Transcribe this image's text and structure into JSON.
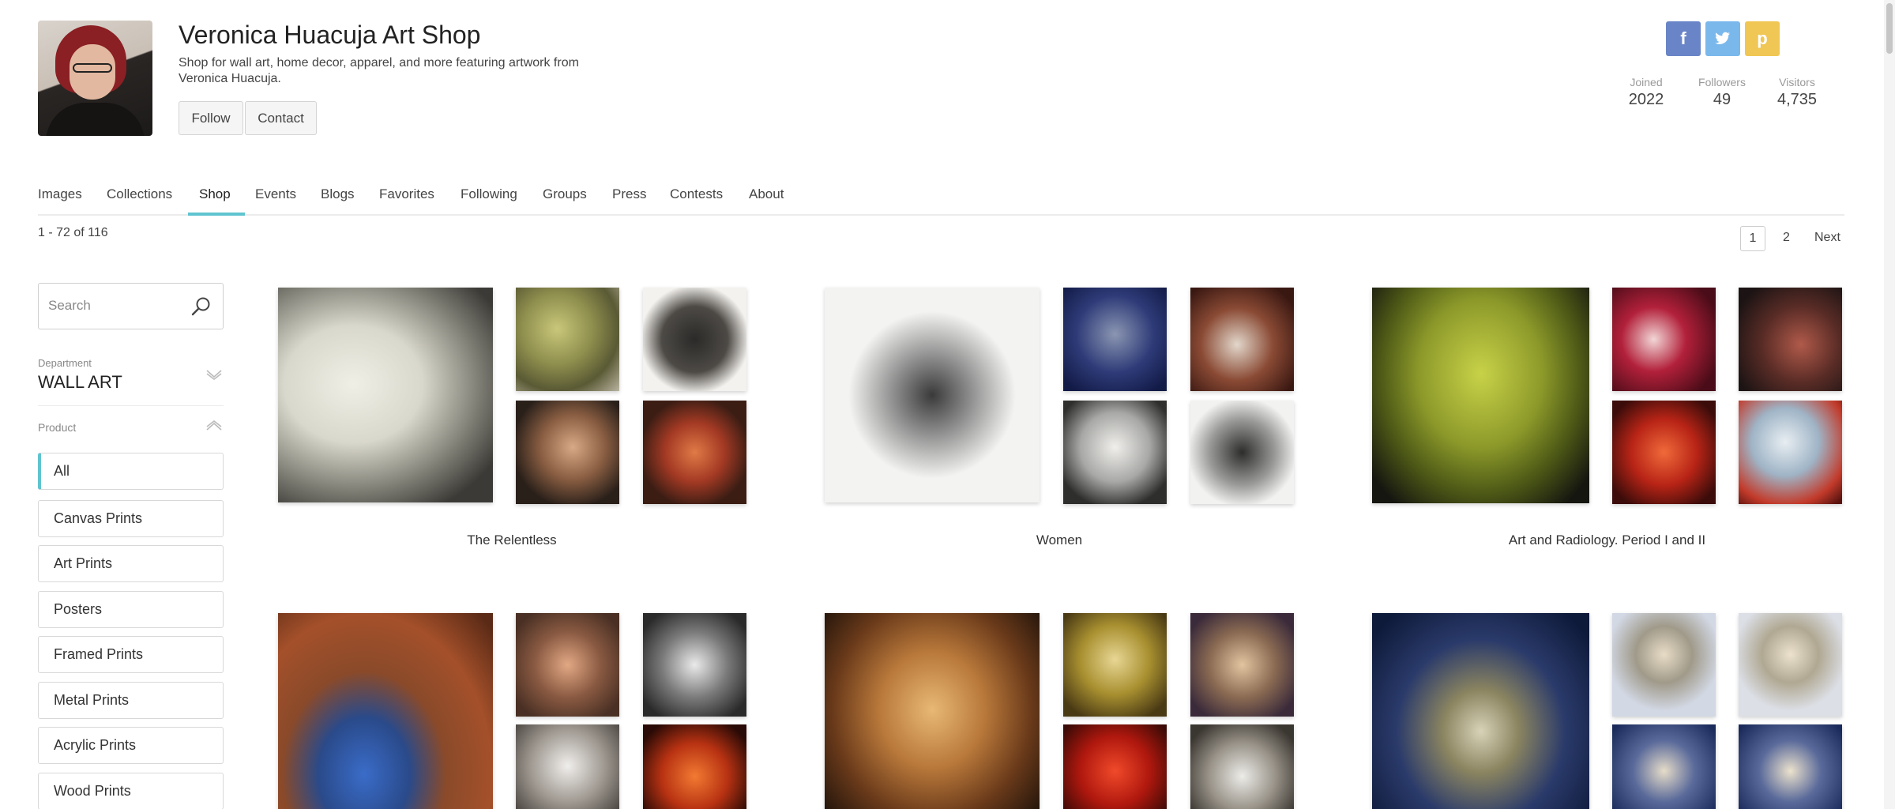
{
  "header": {
    "title": "Veronica Huacuja Art Shop",
    "description": "Shop for wall art, home decor, apparel, and more featuring artwork from Veronica Huacuja.",
    "follow_label": "Follow",
    "contact_label": "Contact"
  },
  "social": {
    "facebook_glyph": "f",
    "twitter_glyph": "🐦",
    "pinterest_glyph": "p"
  },
  "stats": [
    {
      "label": "Joined",
      "value": "2022"
    },
    {
      "label": "Followers",
      "value": "49"
    },
    {
      "label": "Visitors",
      "value": "4,735"
    }
  ],
  "tabs": [
    "Images",
    "Collections",
    "Shop",
    "Events",
    "Blogs",
    "Favorites",
    "Following",
    "Groups",
    "Press",
    "Contests",
    "About"
  ],
  "active_tab": "Shop",
  "results": "1 - 72 of 116",
  "pagination": {
    "current": "1",
    "page2": "2",
    "next": "Next"
  },
  "sidebar": {
    "search_placeholder": "Search",
    "department_label": "Department",
    "department_value": "WALL ART",
    "product_label": "Product",
    "products": [
      "All",
      "Canvas Prints",
      "Art Prints",
      "Posters",
      "Framed Prints",
      "Metal Prints",
      "Acrylic Prints",
      "Wood Prints"
    ]
  },
  "collections": [
    {
      "title": "The Relentless"
    },
    {
      "title": "Women"
    },
    {
      "title": "Art and Radiology. Period I and II"
    },
    {
      "title": ""
    },
    {
      "title": ""
    },
    {
      "title": ""
    }
  ],
  "colors": {
    "accent": "#5fc4cf",
    "facebook": "#6a85c7",
    "twitter": "#7ab8ec",
    "pinterest": "#f0c654"
  }
}
